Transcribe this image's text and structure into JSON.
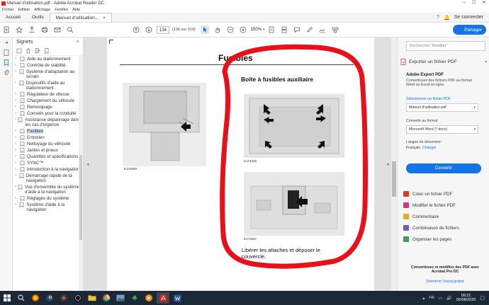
{
  "window": {
    "title": "Manuel d'utilisation.pdf - Adobe Acrobat Reader DC",
    "minimize": "–",
    "maximize": "☐",
    "close": "✕"
  },
  "menu": [
    "Fichier",
    "Edition",
    "Affichage",
    "Fenêtre",
    "Aide"
  ],
  "tabs": {
    "home": "Accueil",
    "tools": "Outils",
    "document": "Manuel d'utilisation...",
    "close": "×",
    "connect": "Se connecter"
  },
  "toolbar": {
    "page_current": "134",
    "page_total": "(136 sur 314)",
    "zoom": "150%",
    "share": "Partager"
  },
  "bookmarks": {
    "title": "Signets",
    "items": [
      {
        "label": "Aide au stationnement",
        "expand": true
      },
      {
        "label": "Contrôle de stabilité",
        "expand": true
      },
      {
        "label": "Système d'adaptation au terrain",
        "expand": true
      },
      {
        "label": "Dispositifs d'aide au stationnement",
        "expand": true
      },
      {
        "label": "Régulateur de vitesse",
        "expand": true
      },
      {
        "label": "Chargement du véhicule",
        "expand": true
      },
      {
        "label": "Remorquage",
        "expand": true
      },
      {
        "label": "Conseils pour la conduite",
        "expand": true
      },
      {
        "label": "Assistance dépannage dans les cas d'urgence",
        "expand": true
      },
      {
        "label": "Fusibles",
        "expand": true,
        "selected": true
      },
      {
        "label": "Entretien",
        "expand": true
      },
      {
        "label": "Nettoyage du véhicule",
        "expand": true
      },
      {
        "label": "Jantes et pneus",
        "expand": true
      },
      {
        "label": "Quantités et spécifications",
        "expand": true
      },
      {
        "label": "SYNC™",
        "expand": true
      },
      {
        "label": "Introduction à la navigation",
        "expand": true
      },
      {
        "label": "Démarrage rapide de la navigation",
        "expand": true
      },
      {
        "label": "Vue d'ensemble du système d'aide à la navigation",
        "expand": true
      },
      {
        "label": "Réglages du système",
        "expand": true
      },
      {
        "label": "Système d'aide à la navigation",
        "expand": true
      }
    ]
  },
  "pdf": {
    "heading": "Fusibles",
    "subheading": "Boîte à fusibles auxiliaire",
    "left_figure_id": "E134659",
    "fig1_id": "E174325",
    "fig2_id": "E173637",
    "caption": "Libérer les attaches et déposer le couvercle."
  },
  "right_panel": {
    "search_placeholder": "Rechercher \"Modifier\"",
    "export_title": "Exporter un fichier PDF",
    "adobe_export": "Adobe Export PDF",
    "export_desc": "Convertissez des fichiers PDF au format Word ou Excel en ligne.",
    "select_file": "Sélectionner un fichier PDF",
    "file_name": "Manuel d'utilisation.pdf",
    "convert_to": "Convertir au format",
    "format": "Microsoft Word (*.docx)",
    "doc_lang": "Langue du document :",
    "lang_value": "Français",
    "change": "Changer",
    "convert_btn": "Convertir",
    "tools": [
      {
        "label": "Créer un fichier PDF",
        "color": "#e0392b"
      },
      {
        "label": "Modifier le fichier PDF",
        "color": "#d4357a"
      },
      {
        "label": "Commentaire",
        "color": "#e9a81f"
      },
      {
        "label": "Combinaison de fichiers",
        "color": "#6c5cc9"
      },
      {
        "label": "Organiser les pages",
        "color": "#3aa04a"
      }
    ],
    "promo": "Convertissez et modifiez des PDF avec Acrobat Pro DC",
    "trial": "Démarrer l'essai gratuit"
  },
  "taskbar": {
    "lang": "FR",
    "time": "09:21",
    "date": "02/08/2020"
  },
  "colors": {
    "accent": "#1473e6",
    "highlight_circle": "#e8111a"
  }
}
